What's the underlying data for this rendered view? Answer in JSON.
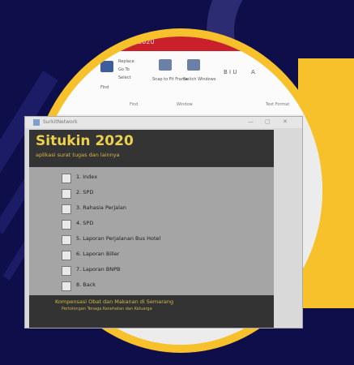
{
  "word_title": "... 2020",
  "ribbon": {
    "items": [
      "Replace",
      "Go To",
      "Select",
      "Find",
      "Snap to Fit Frame",
      "Switch Windows",
      "B I U",
      "A"
    ],
    "groups": [
      "Find",
      "Window",
      "Text Format"
    ]
  },
  "app": {
    "window_title": "SurkitNetwork",
    "controls": [
      "—",
      "▢",
      "✕"
    ],
    "title": "Situkin 2020",
    "subtitle": "aplikasi surat tugas dan lainnya",
    "menu": [
      "1. Index",
      "2. SPD",
      "3. Rahasia Perjalan",
      "4. SPD",
      "5. Laporan Perjalanan Bus Hotel",
      "6. Laporan Biller",
      "7. Laporan BNPB",
      "8. Back"
    ],
    "footer_line1": "Kompensasi Obat dan Makanan di Semarang",
    "footer_line2": "Pertolongan Tenaga Kesehatan dan Keluarga"
  },
  "colors": {
    "background": "#0e0e4a",
    "ring": "#f6c12b",
    "header": "#343434",
    "title": "#ecd04e",
    "titlebar": "#c9202a"
  }
}
